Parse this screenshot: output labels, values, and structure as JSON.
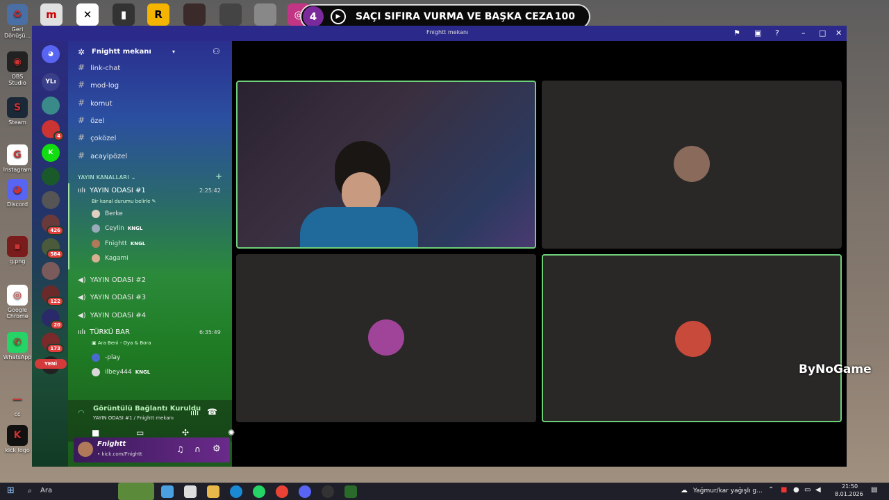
{
  "desktop": {
    "icons": [
      {
        "label": "Geri Dönüşü...",
        "glyph": "♻",
        "color": "#4a6fa5"
      },
      {
        "label": "OBS Studio",
        "glyph": "◉",
        "color": "#222"
      },
      {
        "label": "Steam",
        "glyph": "S",
        "color": "#1b2838"
      },
      {
        "label": "Instagram",
        "glyph": "G",
        "color": "#ffffff"
      },
      {
        "label": "Discord",
        "glyph": "◕",
        "color": "#5865f2"
      },
      {
        "label": "g.png",
        "glyph": "▪",
        "color": "#7a1c1c"
      },
      {
        "label": "Google Chrome",
        "glyph": "◎",
        "color": "#ffffff"
      },
      {
        "label": "WhatsApp",
        "glyph": "✆",
        "color": "#25d366"
      },
      {
        "label": "cc",
        "glyph": "—",
        "color": "transparent"
      },
      {
        "label": "kick logo",
        "glyph": "K",
        "color": "#111"
      }
    ]
  },
  "overlay": {
    "number": "4",
    "title": "SAÇI SIFIRA VURMA VE BAŞKA CEZA",
    "score": "100"
  },
  "window": {
    "title": "Fnightt mekanı"
  },
  "server": {
    "name": "Fnightt mekanı",
    "rail": [
      {
        "label": "YLı",
        "badge": ""
      },
      {
        "label": "",
        "badge": ""
      },
      {
        "label": "",
        "badge": "4"
      },
      {
        "label": "K",
        "badge": ""
      },
      {
        "label": "",
        "badge": ""
      },
      {
        "label": "",
        "badge": ""
      },
      {
        "label": "",
        "badge": "426"
      },
      {
        "label": "",
        "badge": "584"
      },
      {
        "label": "",
        "badge": ""
      },
      {
        "label": "",
        "badge": "122"
      },
      {
        "label": "",
        "badge": "20"
      },
      {
        "label": "",
        "badge": "173"
      },
      {
        "label": "X",
        "badge": ""
      }
    ],
    "new_label": "YENİ",
    "text_channels": [
      "link-chat",
      "mod-log",
      "komut",
      "özel",
      "çoközel",
      "acayipözel"
    ],
    "category": "YAYIN KANALLARI",
    "voice1": {
      "name": "YAYIN ODASI #1",
      "time": "2:25:42",
      "status": "Bir kanal durumu belirle",
      "users": [
        {
          "name": "Berke",
          "tag": ""
        },
        {
          "name": "Ceylin",
          "tag": "KNGL"
        },
        {
          "name": "Fnightt",
          "tag": "KNGL"
        },
        {
          "name": "Kagami",
          "tag": ""
        }
      ]
    },
    "voice_others": [
      "YAYIN ODASI #2",
      "YAYIN ODASI #3",
      "YAYIN ODASI #4"
    ],
    "voice2": {
      "name": "TÜRKÜ BAR",
      "time": "6:35:49",
      "status": "Ara Beni - Oya & Bora",
      "users": [
        {
          "name": "-play",
          "tag": ""
        },
        {
          "name": "ilbey444",
          "tag": "KNGL"
        }
      ]
    }
  },
  "connection": {
    "title": "Görüntülü Bağlantı Kuruldu",
    "subtitle": "YAYIN ODASI #1 / Fnightt mekanı"
  },
  "user": {
    "name": "Fnightt",
    "status": "• kick.com/Fnightt"
  },
  "watermark": "ByNoGame",
  "taskbar": {
    "search": "Ara",
    "weather": "Yağmur/kar yağışlı g...",
    "time": "21:50",
    "date": "8.01.2026"
  }
}
